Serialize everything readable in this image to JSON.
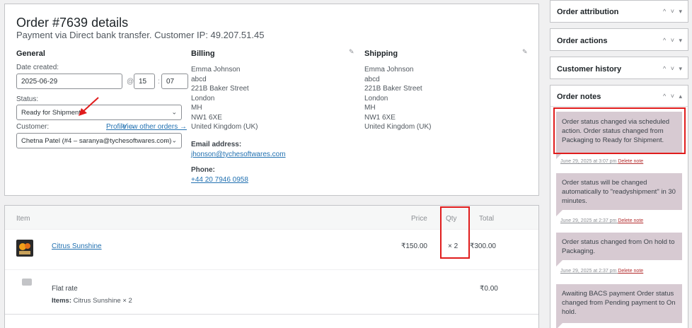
{
  "order": {
    "title": "Order #7639 details",
    "subtitle": "Payment via Direct bank transfer. Customer IP: 49.207.51.45"
  },
  "general": {
    "heading": "General",
    "date_label": "Date created:",
    "date_value": "2025-06-29",
    "at_sep": "@",
    "hour_value": "15",
    "colon_sep": ":",
    "minute_value": "07",
    "status_label": "Status:",
    "status_value": "Ready for Shipment",
    "customer_label": "Customer:",
    "profile_link": "Profile →",
    "other_orders_link": "View other orders →",
    "customer_value": "Chetna Patel (#4 – saranya@tychesoftwares.com)"
  },
  "billing": {
    "heading": "Billing",
    "lines": [
      "Emma Johnson",
      "abcd",
      "221B Baker Street",
      "London",
      "MH",
      "NW1 6XE",
      "United Kingdom (UK)"
    ],
    "email_label": "Email address:",
    "email_value": "jhonson@tychesoftwares.com",
    "phone_label": "Phone:",
    "phone_value": "+44 20 7946 0958"
  },
  "shipping": {
    "heading": "Shipping",
    "lines": [
      "Emma Johnson",
      "abcd",
      "221B Baker Street",
      "London",
      "MH",
      "NW1 6XE",
      "United Kingdom (UK)"
    ]
  },
  "items": {
    "headers": {
      "item": "Item",
      "price": "Price",
      "qty": "Qty",
      "total": "Total"
    },
    "product": {
      "name": "Citrus Sunshine",
      "price": "₹150.00",
      "qty": "× 2",
      "total": "₹300.00"
    },
    "shipping": {
      "name": "Flat rate",
      "items_label": "Items:",
      "items_value": "Citrus Sunshine × 2",
      "total": "₹0.00"
    }
  },
  "sidebar": {
    "attribution": "Order attribution",
    "actions": "Order actions",
    "history": "Customer history",
    "notes": "Order notes",
    "icons_collapsed": "^ ˅ ▾",
    "icons_open": "^ ˅ ▴"
  },
  "notes": [
    {
      "text": "Order status changed via scheduled action. Order status changed from Packaging to Ready for Shipment.",
      "meta": "June 29, 2025 at 3:07 pm",
      "delete": "Delete note"
    },
    {
      "text": "Order status will be changed automatically to \"readyshipment\" in 30 minutes.",
      "meta": "June 29, 2025 at 2:37 pm",
      "delete": "Delete note"
    },
    {
      "text": "Order status changed from On hold to Packaging.",
      "meta": "June 29, 2025 at 2:37 pm",
      "delete": "Delete note"
    },
    {
      "text": "Awaiting BACS payment Order status changed from Pending payment to On hold.",
      "meta": "",
      "delete": ""
    }
  ],
  "colors": {
    "highlight": "#e01c1c",
    "note_bg": "#d7cad2",
    "link": "#2271b1"
  }
}
